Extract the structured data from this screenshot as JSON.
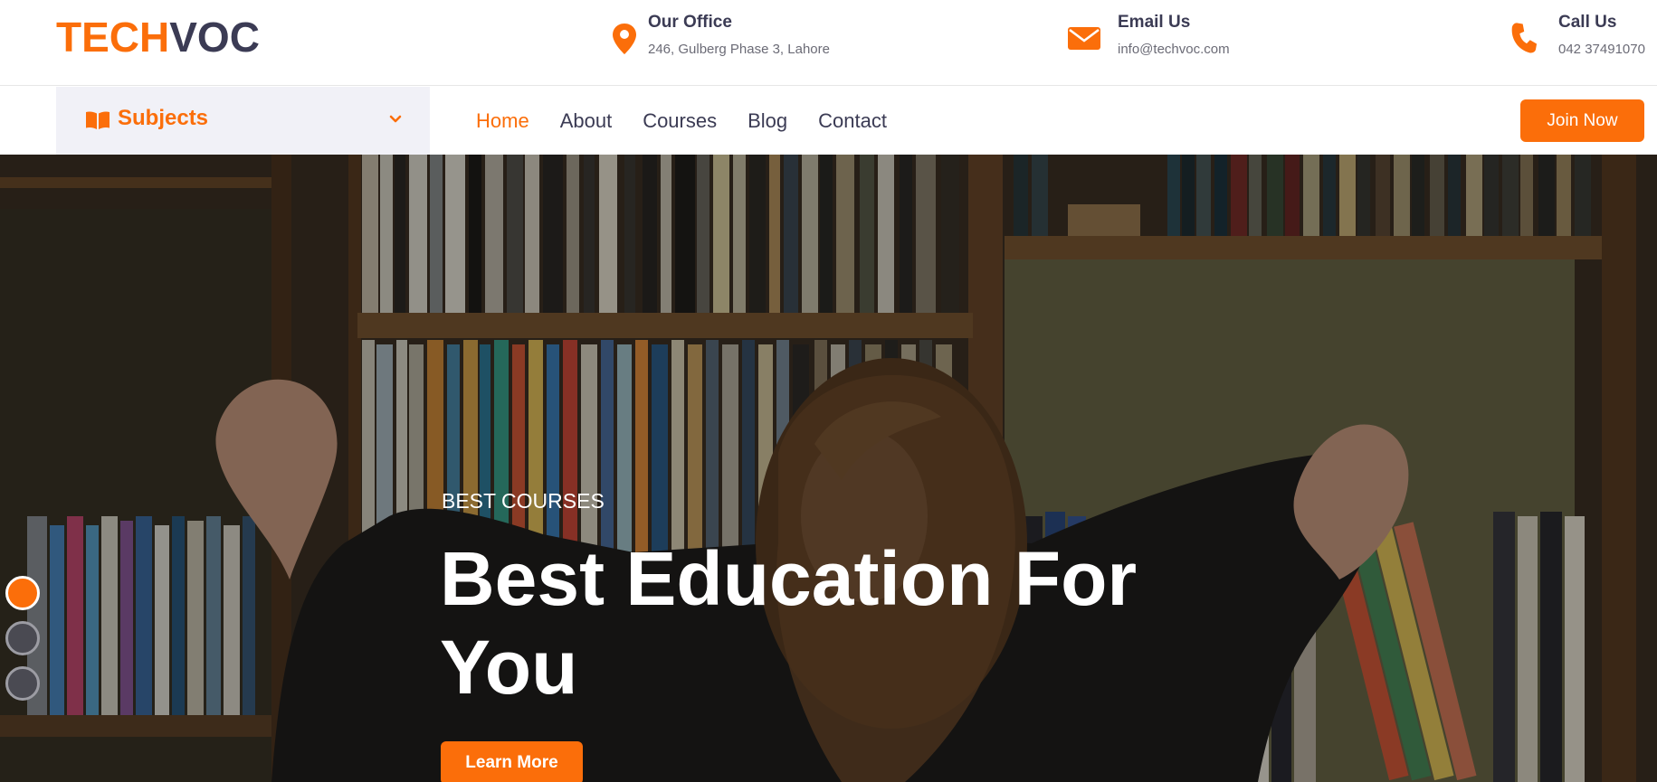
{
  "colors": {
    "accent": "#fb6e0a",
    "dark": "#3b3b54"
  },
  "logo": {
    "part1": "TECH",
    "part2": "VOC"
  },
  "contact": {
    "office": {
      "icon": "map-marker-icon",
      "title": "Our Office",
      "value": "246, Gulberg Phase 3, Lahore"
    },
    "email": {
      "icon": "envelope-icon",
      "title": "Email Us",
      "value": "info@techvoc.com"
    },
    "phone": {
      "icon": "phone-icon",
      "title": "Call Us",
      "value": "042 37491070"
    }
  },
  "nav": {
    "subjects": {
      "icon": "book-icon",
      "label": "Subjects",
      "chevron": "chevron-down-icon"
    },
    "items": [
      {
        "label": "Home",
        "active": true
      },
      {
        "label": "About",
        "active": false
      },
      {
        "label": "Courses",
        "active": false
      },
      {
        "label": "Blog",
        "active": false
      },
      {
        "label": "Contact",
        "active": false
      }
    ],
    "cta": "Join Now"
  },
  "hero": {
    "kicker": "BEST COURSES",
    "headline": "Best Education For You",
    "button": "Learn More",
    "slides": {
      "count": 3,
      "active": 1
    }
  }
}
